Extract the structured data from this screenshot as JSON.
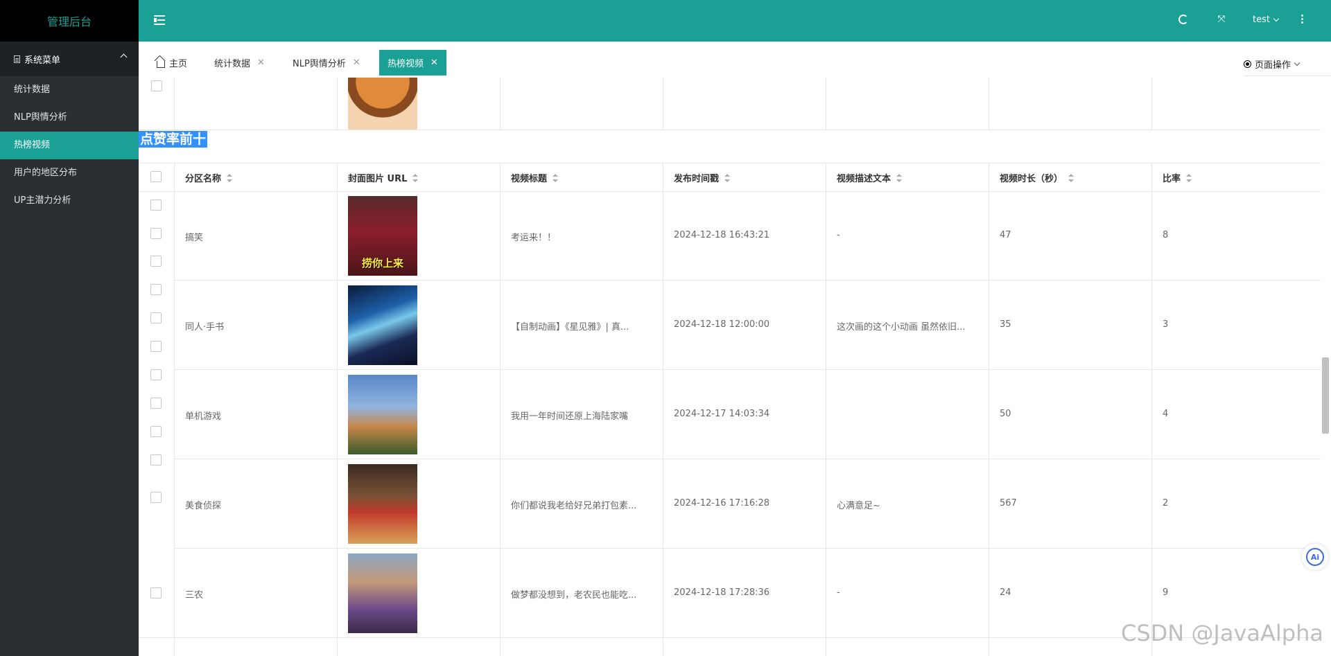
{
  "sidebar": {
    "logo": "管理后台",
    "group_label": "系统菜单",
    "items": [
      {
        "label": "统计数据"
      },
      {
        "label": "NLP舆情分析"
      },
      {
        "label": "热榜视频"
      },
      {
        "label": "用户的地区分布"
      },
      {
        "label": "UP主潜力分析"
      }
    ]
  },
  "header": {
    "user": "test",
    "icons": [
      "menu-fold-icon",
      "refresh-icon",
      "fullscreen-icon",
      "more-icon"
    ]
  },
  "tabs": [
    {
      "label": "主页"
    },
    {
      "label": "统计数据"
    },
    {
      "label": "NLP舆情分析"
    },
    {
      "label": "热榜视频"
    }
  ],
  "page_ops": "页面操作",
  "section_title": "点赞率前十",
  "table": {
    "columns": [
      "分区名称",
      "封面图片 URL",
      "视频标题",
      "发布时间戳",
      "视频描述文本",
      "视频时长（秒）",
      "比率"
    ],
    "rows": [
      {
        "category": "搞笑",
        "title": "考运来！！",
        "time": "2024-12-18 16:43:21",
        "desc": "-",
        "duration": "47",
        "ratio": "8",
        "cover_caption": "捞你上来"
      },
      {
        "category": "同人·手书",
        "title": "【自制动画】《星见雅》| 真...",
        "time": "2024-12-18 12:00:00",
        "desc": "这次画的这个小动画 虽然依旧...",
        "duration": "35",
        "ratio": "3",
        "cover_caption": ""
      },
      {
        "category": "单机游戏",
        "title": "我用一年时间还原上海陆家嘴",
        "time": "2024-12-17 14:03:34",
        "desc": "",
        "duration": "50",
        "ratio": "4",
        "cover_caption": ""
      },
      {
        "category": "美食侦探",
        "title": "你们都说我老给好兄弟打包素...",
        "time": "2024-12-16 17:16:28",
        "desc": "心满意足~",
        "duration": "567",
        "ratio": "2",
        "cover_caption": ""
      },
      {
        "category": "三农",
        "title": "做梦都没想到，老农民也能吃...",
        "time": "2024-12-18 17:28:36",
        "desc": "-",
        "duration": "24",
        "ratio": "9",
        "cover_caption": ""
      }
    ]
  },
  "ai_button": "Ai",
  "watermark": "CSDN @JavaAlpha",
  "colors": {
    "accent": "#1aa094",
    "sidebar": "#2b2f33",
    "selection": "#3390ff"
  }
}
